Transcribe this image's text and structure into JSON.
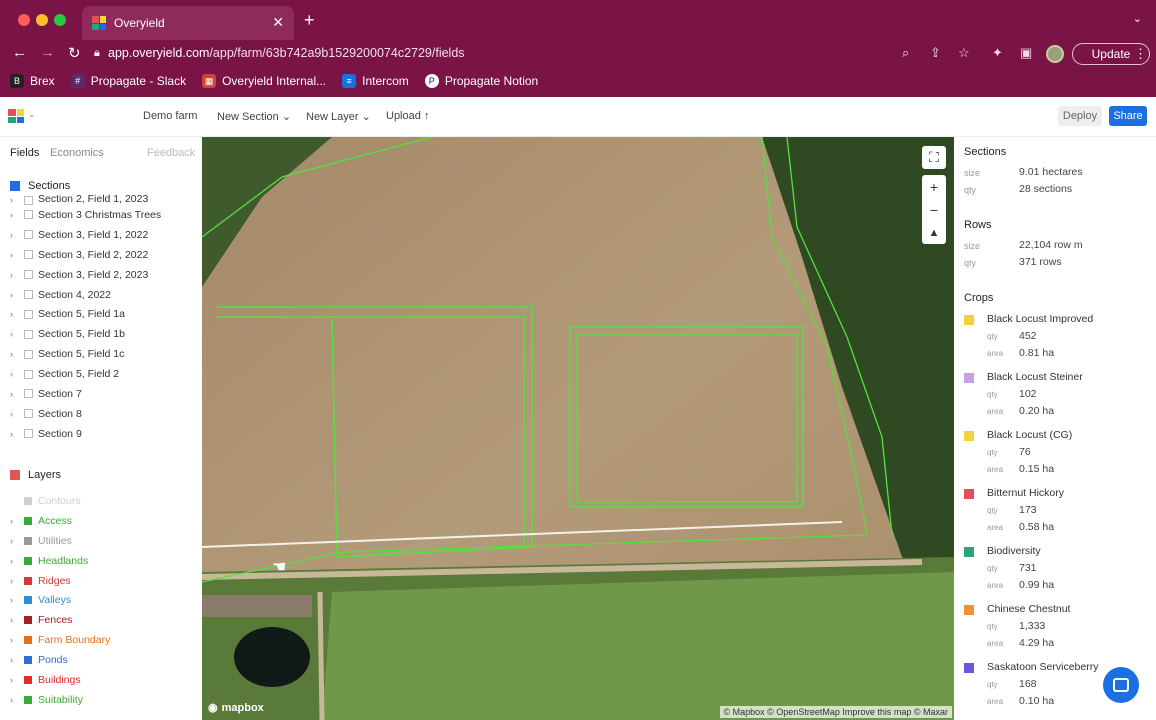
{
  "browser": {
    "tab_title": "Overyield",
    "url_host": "app.overyield.com",
    "url_path": "/app/farm/63b742a9b1529200074c2729/fields",
    "update_label": "Update",
    "bookmarks": [
      "Brex",
      "Propagate - Slack",
      "Overyield Internal...",
      "Intercom",
      "Propagate Notion"
    ]
  },
  "appbar": {
    "farm_label": "Demo farm",
    "new_section": "New Section",
    "new_layer": "New Layer",
    "upload": "Upload",
    "deploy": "Deploy",
    "share": "Share"
  },
  "left": {
    "tabs": [
      "Fields",
      "Economics",
      "Feedback"
    ],
    "sections_header": "Sections",
    "sections": [
      "Section 2, Field 1, 2023",
      "Section 3 Christmas Trees",
      "Section 3, Field 1, 2022",
      "Section 3, Field 2, 2022",
      "Section 3, Field 2, 2023",
      "Section 4, 2022",
      "Section 5, Field 1a",
      "Section 5, Field 1b",
      "Section 5, Field 1c",
      "Section 5, Field 2",
      "Section 7",
      "Section 8",
      "Section 9"
    ],
    "layers_header": "Layers",
    "layers": [
      {
        "label": "Contours",
        "color": "#cfcfcf"
      },
      {
        "label": "Access",
        "color": "#3aaa35"
      },
      {
        "label": "Utilities",
        "color": "#9a9a9a"
      },
      {
        "label": "Headlands",
        "color": "#3aaa35"
      },
      {
        "label": "Ridges",
        "color": "#d33a3a"
      },
      {
        "label": "Valleys",
        "color": "#2d8fd6"
      },
      {
        "label": "Fences",
        "color": "#a32020"
      },
      {
        "label": "Farm Boundary",
        "color": "#e0711c"
      },
      {
        "label": "Ponds",
        "color": "#2d6fd6"
      },
      {
        "label": "Buildings",
        "color": "#e02b2b"
      },
      {
        "label": "Suitability",
        "color": "#3aaa35"
      }
    ]
  },
  "map": {
    "attribution": "© Mapbox © OpenStreetMap Improve this map © Maxar",
    "brand": "mapbox"
  },
  "right": {
    "sections_header": "Sections",
    "sections_size_label": "size",
    "sections_size": "9.01 hectares",
    "sections_qty_label": "qty",
    "sections_qty": "28 sections",
    "rows_header": "Rows",
    "rows_size_label": "size",
    "rows_size": "22,104 row m",
    "rows_qty_label": "qty",
    "rows_qty": "371 rows",
    "crops_header": "Crops",
    "crops": [
      {
        "name": "Black Locust Improved",
        "qty": "452",
        "area": "0.81 ha",
        "color": "#f2d33d"
      },
      {
        "name": "Black Locust Steiner",
        "qty": "102",
        "area": "0.20 ha",
        "color": "#c9a0e8"
      },
      {
        "name": "Black Locust (CG)",
        "qty": "76",
        "area": "0.15 ha",
        "color": "#f2d33d"
      },
      {
        "name": "Bitternut Hickory",
        "qty": "173",
        "area": "0.58 ha",
        "color": "#e0505a"
      },
      {
        "name": "Biodiversity",
        "qty": "731",
        "area": "0.99 ha",
        "color": "#2aa37a"
      },
      {
        "name": "Chinese Chestnut",
        "qty": "1,333",
        "area": "4.29 ha",
        "color": "#f0913a"
      },
      {
        "name": "Saskatoon Serviceberry",
        "qty": "168",
        "area": "0.10 ha",
        "color": "#6a55e0"
      }
    ]
  }
}
